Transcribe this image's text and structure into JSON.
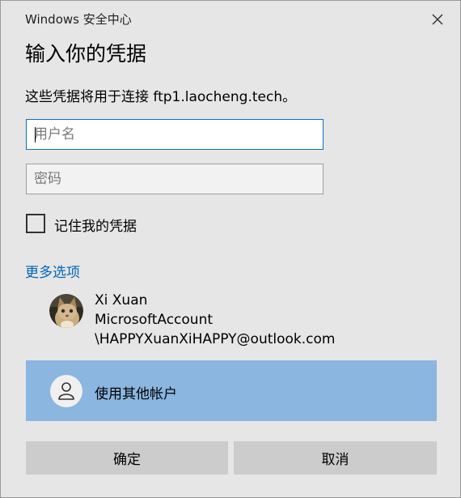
{
  "dialog": {
    "title": "Windows 安全中心",
    "heading": "输入你的凭据",
    "description": "这些凭据将用于连接 ftp1.laocheng.tech。"
  },
  "form": {
    "username_value": "",
    "username_placeholder": "用户名",
    "password_value": "",
    "password_placeholder": "密码",
    "remember_label": "记住我的凭据",
    "remember_checked": false
  },
  "more_options": {
    "label": "更多选项",
    "account": {
      "name": "Xi Xuan",
      "type": "MicrosoftAccount",
      "id": "\\HAPPYXuanXiHAPPY@outlook.com"
    },
    "other_account_label": "使用其他帐户"
  },
  "buttons": {
    "ok": "确定",
    "cancel": "取消"
  },
  "colors": {
    "dialog_bg": "#e6e6e6",
    "accent_link": "#0067b8",
    "focus_border": "#0a6fc2",
    "selected_item_bg": "#8ab6e0",
    "button_bg": "#cccccc"
  },
  "icons": {
    "close": "close-icon",
    "avatar": "cat-photo-avatar",
    "other_account": "person-icon"
  }
}
